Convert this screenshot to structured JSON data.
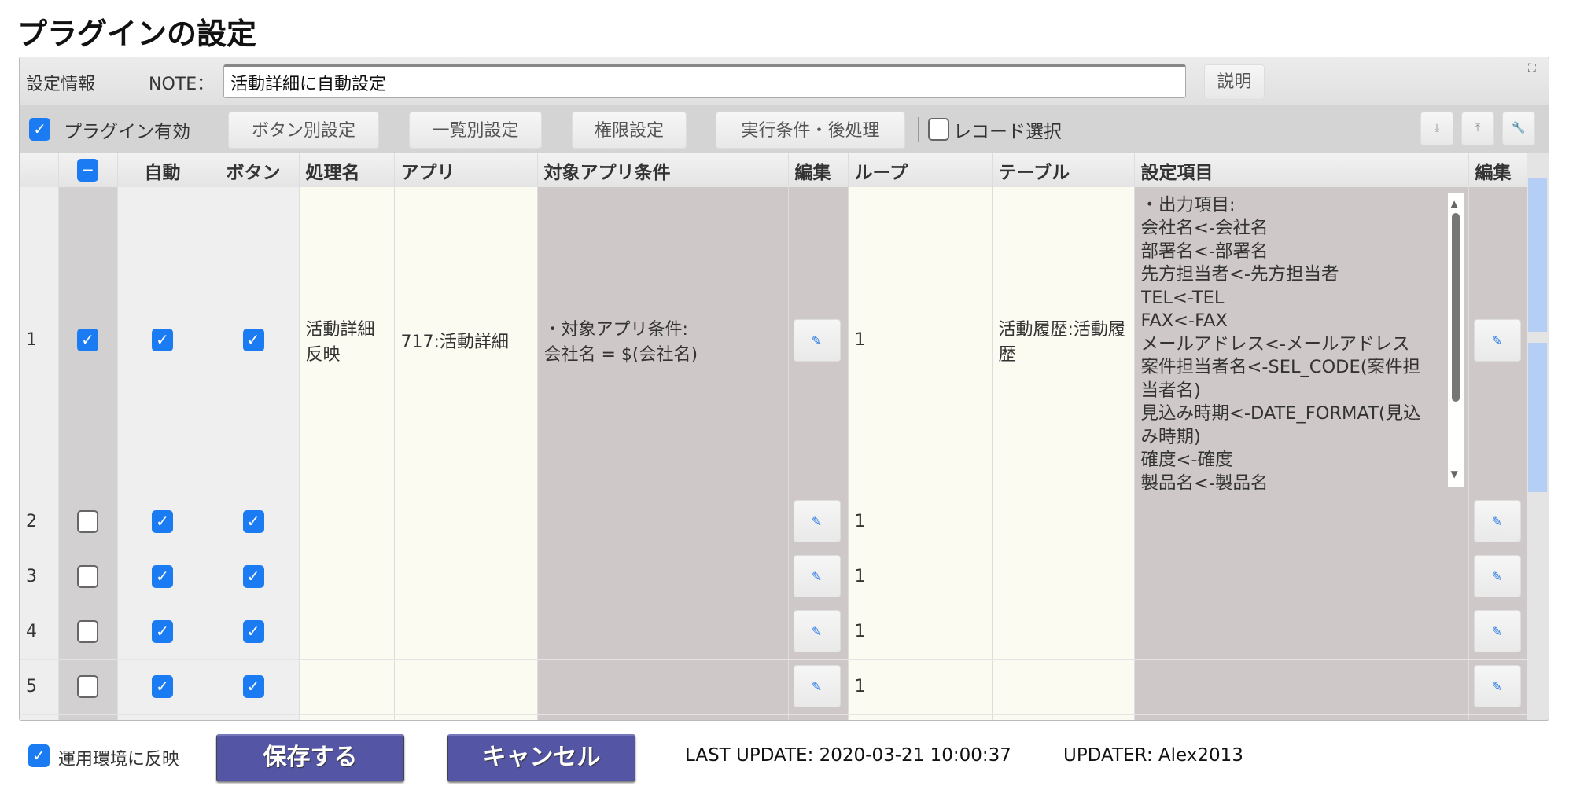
{
  "page_title": "プラグインの設定",
  "info": {
    "section_label": "設定情報",
    "note_label": "NOTE：",
    "note_value": "活動詳細に自動設定",
    "help_button": "説明"
  },
  "toolbar": {
    "plugin_enabled_label": "プラグイン有効",
    "plugin_enabled": true,
    "buttons": [
      "ボタン別設定",
      "一覧別設定",
      "権限設定",
      "実行条件・後処理"
    ],
    "record_select_label": "レコード選択",
    "record_select": false,
    "icons": [
      "download-icon",
      "upload-icon",
      "wrench-icon"
    ]
  },
  "table": {
    "headers": [
      "",
      "",
      "自動",
      "ボタン",
      "処理名",
      "アプリ",
      "対象アプリ条件",
      "編集",
      "ループ",
      "テーブル",
      "設定項目",
      "編集"
    ],
    "rows": [
      {
        "num": "1",
        "selected": true,
        "auto": true,
        "button": true,
        "name": "活動詳細反映",
        "app": "717:活動詳細",
        "condition": "・対象アプリ条件:\n会社名 = $(会社名)",
        "loop": "1",
        "table": "活動履歴:活動履歴",
        "settings": "・出力項目:\n会社名<-会社名\n部署名<-部署名\n先方担当者<-先方担当者\nTEL<-TEL\nFAX<-FAX\nメールアドレス<-メールアドレス\n案件担当者名<-SEL_CODE(案件担当者名)\n見込み時期<-DATE_FORMAT(見込み時期)\n確度<-確度\n製品名<-製品名"
      },
      {
        "num": "2",
        "selected": false,
        "auto": true,
        "button": true,
        "name": "",
        "app": "",
        "condition": "",
        "loop": "1",
        "table": "",
        "settings": ""
      },
      {
        "num": "3",
        "selected": false,
        "auto": true,
        "button": true,
        "name": "",
        "app": "",
        "condition": "",
        "loop": "1",
        "table": "",
        "settings": ""
      },
      {
        "num": "4",
        "selected": false,
        "auto": true,
        "button": true,
        "name": "",
        "app": "",
        "condition": "",
        "loop": "1",
        "table": "",
        "settings": ""
      },
      {
        "num": "5",
        "selected": false,
        "auto": true,
        "button": true,
        "name": "",
        "app": "",
        "condition": "",
        "loop": "1",
        "table": "",
        "settings": ""
      }
    ]
  },
  "footer": {
    "reflect_label": "運用環境に反映",
    "reflect": true,
    "save_button": "保存する",
    "cancel_button": "キャンセル",
    "last_update": "LAST UPDATE: 2020-03-21 10:00:37",
    "updater": "UPDATER: Alex2013"
  },
  "colors": {
    "accent": "#1a7bf2",
    "primary_button": "#5555a5",
    "cream_column": "#fbfbf1",
    "mauve_column": "#cfc8c8"
  }
}
